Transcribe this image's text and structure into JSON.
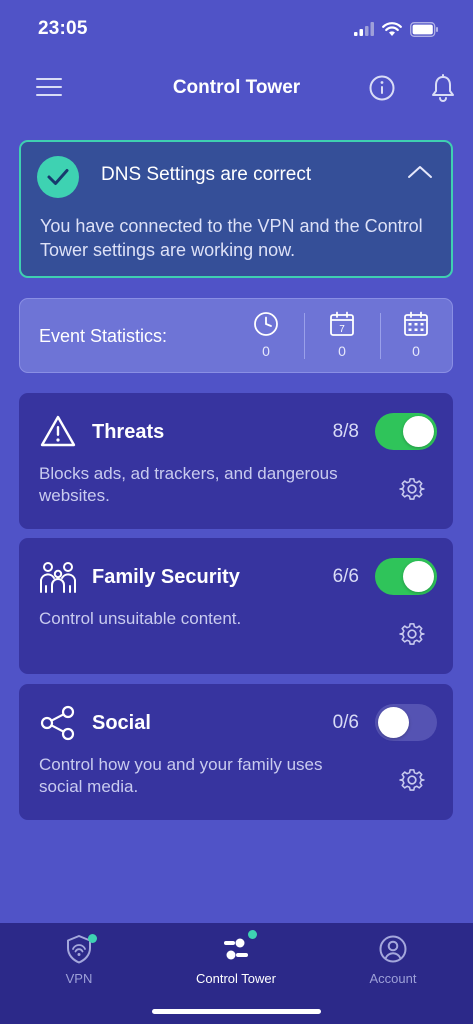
{
  "status_bar": {
    "time": "23:05",
    "icons": [
      "signal-icon",
      "wifi-icon",
      "battery-icon"
    ]
  },
  "header": {
    "title": "Control Tower",
    "menu_icon": "hamburger-menu-icon",
    "info_icon": "info-icon",
    "bell_icon": "bell-icon"
  },
  "dns": {
    "title": "DNS Settings are correct",
    "message": "You have connected to the VPN and the Control Tower settings are working now.",
    "status_icon": "check-circle-icon",
    "accent_color": "#3ed2b2"
  },
  "stats": {
    "label": "Event Statistics:",
    "items": [
      {
        "icon": "clock-icon",
        "value": "0"
      },
      {
        "icon": "calendar-day-icon",
        "value": "0",
        "day": "7"
      },
      {
        "icon": "calendar-month-icon",
        "value": "0"
      }
    ]
  },
  "categories": [
    {
      "title": "Threats",
      "count": "8/8",
      "enabled": true,
      "description": "Blocks ads, ad trackers, and dangerous websites.",
      "icon": "warning-triangle-icon"
    },
    {
      "title": "Family Security",
      "count": "6/6",
      "enabled": true,
      "description": "Control unsuitable content.",
      "icon": "family-icon"
    },
    {
      "title": "Social",
      "count": "0/6",
      "enabled": false,
      "description": "Control how you and your family uses social media.",
      "icon": "share-icon"
    }
  ],
  "tabs": [
    {
      "label": "VPN",
      "icon": "vpn-shield-icon",
      "active": false,
      "badge": true
    },
    {
      "label": "Control Tower",
      "icon": "control-tower-icon",
      "active": true,
      "badge": true
    },
    {
      "label": "Account",
      "icon": "account-icon",
      "active": false,
      "badge": false
    }
  ],
  "colors": {
    "background": "#5053c7",
    "card": "#37349f",
    "toggle_on": "#2fc45a",
    "tab_bar": "#2c2989"
  }
}
